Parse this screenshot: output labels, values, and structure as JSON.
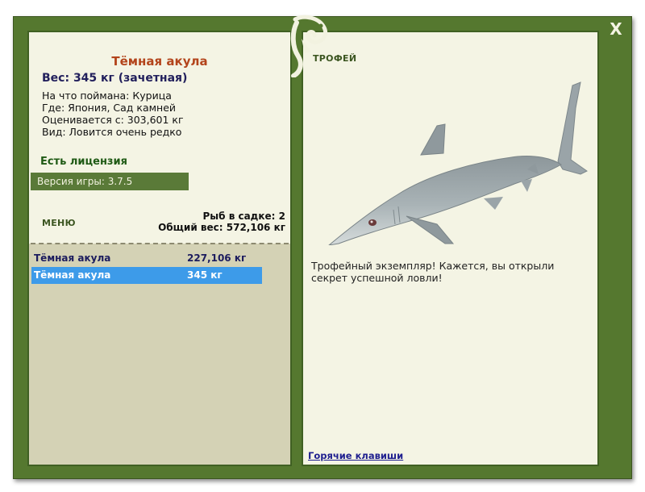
{
  "window": {
    "close_label": "X"
  },
  "fish": {
    "title": "Тёмная акула",
    "weight_line": "Вес: 345 кг (зачетная)",
    "bait_line": "На что поймана: Курица",
    "location_line": "Где: Япония, Сад камней",
    "rated_line": "Оценивается с: 303,601 кг",
    "type_line": "Вид: Ловится очень редко"
  },
  "license": {
    "label": "Есть лицензия"
  },
  "version": {
    "label": "Версия игры: 3.7.5"
  },
  "menu": {
    "label": "МЕНЮ"
  },
  "keepnet": {
    "count_line": "Рыб в садке: 2",
    "total_line": "Общий вес: 572,106 кг"
  },
  "catches": [
    {
      "name": "Тёмная акула",
      "weight": "227,106 кг",
      "selected": false
    },
    {
      "name": "Тёмная акула",
      "weight": "345 кг",
      "selected": true
    }
  ],
  "trophy": {
    "label": "ТРОФЕЙ",
    "description": "Трофейный экземпляр! Кажется, вы открыли секрет успешной ловли!"
  },
  "hotkeys": {
    "label": "Горячие клавиши"
  },
  "colors": {
    "frame": "#55782f",
    "panel": "#f4f4e4",
    "list_bg": "#d4d2b5",
    "title": "#b3441b",
    "selected_row": "#3d9be9"
  }
}
